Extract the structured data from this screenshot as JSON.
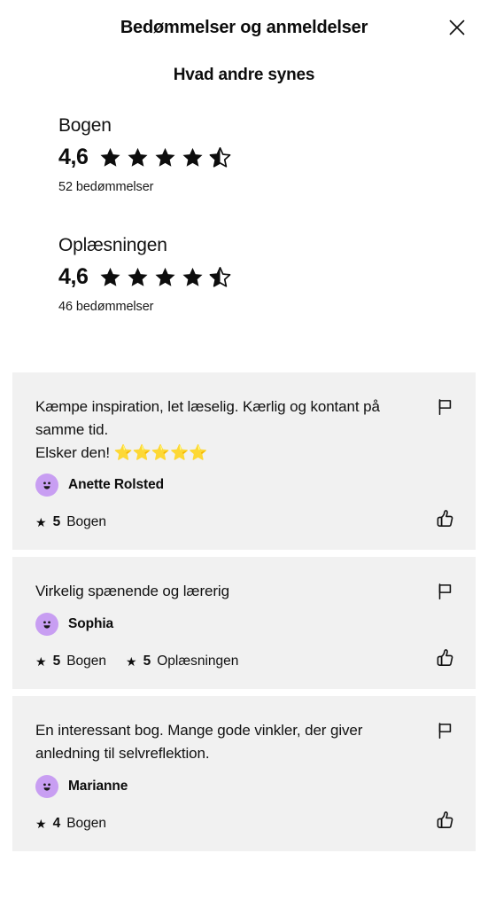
{
  "header": {
    "title": "Bedømmelser og anmeldelser",
    "close_icon": "close-icon",
    "subtitle": "Hvad andre synes"
  },
  "ratings": [
    {
      "label": "Bogen",
      "score": "4,6",
      "stars_filled": 4,
      "has_half_star": true,
      "count_text": "52 bedømmelser"
    },
    {
      "label": "Oplæsningen",
      "score": "4,6",
      "stars_filled": 4,
      "has_half_star": true,
      "count_text": "46 bedømmelser"
    }
  ],
  "reviews": [
    {
      "text": "Kæmpe inspiration, let læselig. Kærlig og kontant på samme tid.\nElsker den! ",
      "emoji_stars": "⭐⭐⭐⭐⭐",
      "reviewer": "Anette Rolsted",
      "avatar_icon": "smiley-avatar-icon",
      "scores": [
        {
          "star": "★",
          "value": "5",
          "label": "Bogen"
        }
      ],
      "flag_icon": "flag-icon",
      "like_icon": "thumbs-up-icon"
    },
    {
      "text": "Virkelig spænende og lærerig",
      "emoji_stars": "",
      "reviewer": "Sophia",
      "avatar_icon": "smiley-avatar-icon",
      "scores": [
        {
          "star": "★",
          "value": "5",
          "label": "Bogen"
        },
        {
          "star": "★",
          "value": "5",
          "label": "Oplæsningen"
        }
      ],
      "flag_icon": "flag-icon",
      "like_icon": "thumbs-up-icon"
    },
    {
      "text": "En interessant bog. Mange gode vinkler, der giver anledning til selvreflektion.",
      "emoji_stars": "",
      "reviewer": "Marianne",
      "avatar_icon": "smiley-avatar-icon",
      "scores": [
        {
          "star": "★",
          "value": "4",
          "label": "Bogen"
        }
      ],
      "flag_icon": "flag-icon",
      "like_icon": "thumbs-up-icon"
    }
  ],
  "colors": {
    "page_background": "#ffffff",
    "card_background": "#f1f1f1",
    "text": "#111111",
    "avatar": "#c89ef2",
    "star": "#0d0d0d",
    "emoji_star": "#f5c518"
  }
}
